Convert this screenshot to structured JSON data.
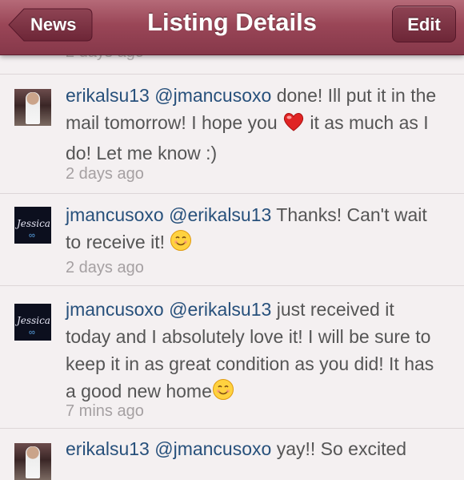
{
  "navbar": {
    "title": "Listing Details",
    "back_label": "News",
    "edit_label": "Edit"
  },
  "previous_timestamp": "2 days ago",
  "comments": [
    {
      "username": "erikalsu13",
      "mention": "@jmancusoxo",
      "text_before": " done! Ill put it in the mail tomorrow! I hope you ",
      "emoji": "heart",
      "text_after": " it as much as I do! Let me know :)",
      "time": "2 days ago"
    },
    {
      "username": "jmancusoxo",
      "mention": "@erikalsu13",
      "text_before": " Thanks! Can't wait to receive it! ",
      "emoji": "smiley",
      "time": "2 days ago"
    },
    {
      "username": "jmancusoxo",
      "mention": "@erikalsu13",
      "text_before": " just received it today and I absolutely love it! I will be sure to keep it in as great condition as you did! It has a good new home",
      "emoji": "smiley",
      "time": "7 mins ago"
    },
    {
      "username": "erikalsu13",
      "mention": "@jmancusoxo",
      "text_before": " yay!! So excited"
    }
  ],
  "avatars": {
    "jessica_text": "Jessica"
  },
  "colors": {
    "navbar": "#9a4657",
    "username": "#27507b",
    "body_text": "#555555",
    "timestamp": "#a5a0a2",
    "background": "#f4f0f1"
  }
}
